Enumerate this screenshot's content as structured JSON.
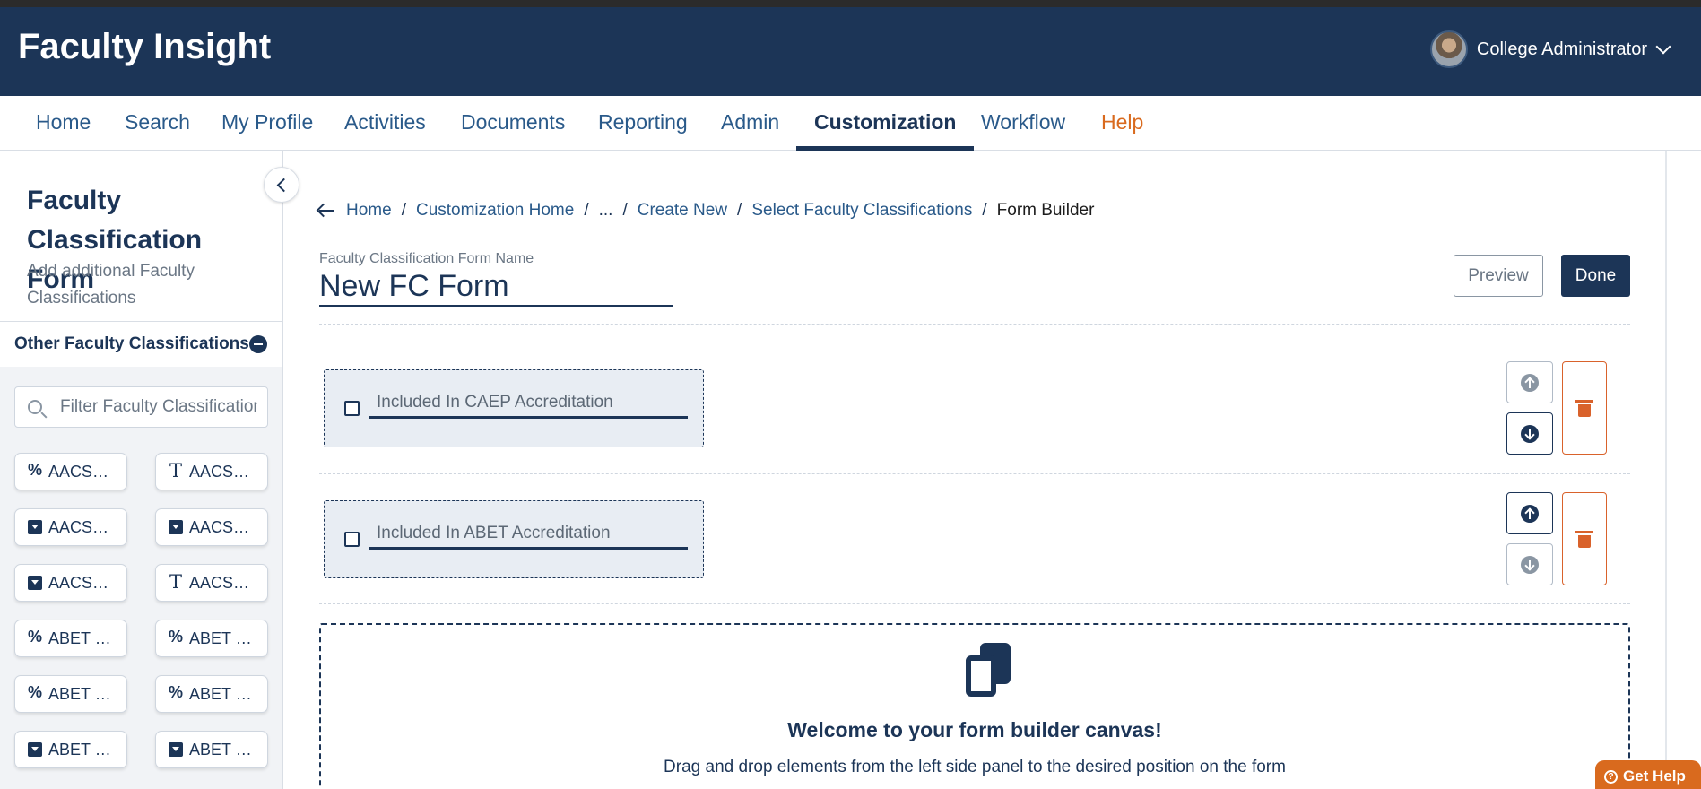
{
  "app": {
    "title": "Faculty Insight"
  },
  "user": {
    "name": "College Administrator"
  },
  "nav": {
    "items": [
      "Home",
      "Search",
      "My Profile",
      "Activities",
      "Documents",
      "Reporting",
      "Admin",
      "Customization",
      "Workflow",
      "Help"
    ],
    "active": "Customization"
  },
  "sidebar": {
    "title": "Faculty Classification Form",
    "subtitle": "Add additional Faculty Classifications",
    "section": "Other Faculty Classifications",
    "filter_placeholder": "Filter Faculty Classifications",
    "chips": [
      {
        "label": "AACS…",
        "icon": "percent-icon"
      },
      {
        "label": "AACS…",
        "icon": "text-icon"
      },
      {
        "label": "AACS…",
        "icon": "dropdown-icon"
      },
      {
        "label": "AACS…",
        "icon": "dropdown-icon"
      },
      {
        "label": "AACS…",
        "icon": "dropdown-icon"
      },
      {
        "label": "AACS…",
        "icon": "text-icon"
      },
      {
        "label": "ABET …",
        "icon": "percent-icon"
      },
      {
        "label": "ABET …",
        "icon": "percent-icon"
      },
      {
        "label": "ABET …",
        "icon": "percent-icon"
      },
      {
        "label": "ABET …",
        "icon": "percent-icon"
      },
      {
        "label": "ABET …",
        "icon": "dropdown-icon"
      },
      {
        "label": "ABET …",
        "icon": "dropdown-icon"
      }
    ]
  },
  "breadcrumb": {
    "items": [
      "Home",
      "Customization Home",
      "...",
      "Create New",
      "Select Faculty Classifications",
      "Form Builder"
    ]
  },
  "form": {
    "name_label": "Faculty Classification Form Name",
    "name_value": "New FC Form",
    "preview_label": "Preview",
    "done_label": "Done",
    "fields": [
      {
        "label": "Included In CAEP Accreditation"
      },
      {
        "label": "Included In ABET Accreditation"
      }
    ]
  },
  "canvas": {
    "title": "Welcome to your form builder canvas!",
    "subtitle": "Drag and drop elements from the left side panel to the desired position on the form"
  },
  "help_button": "Get Help",
  "colors": {
    "primary": "#1c3557",
    "accent": "#d96a1e",
    "link": "#2a5a8a",
    "danger": "#d9622b"
  }
}
